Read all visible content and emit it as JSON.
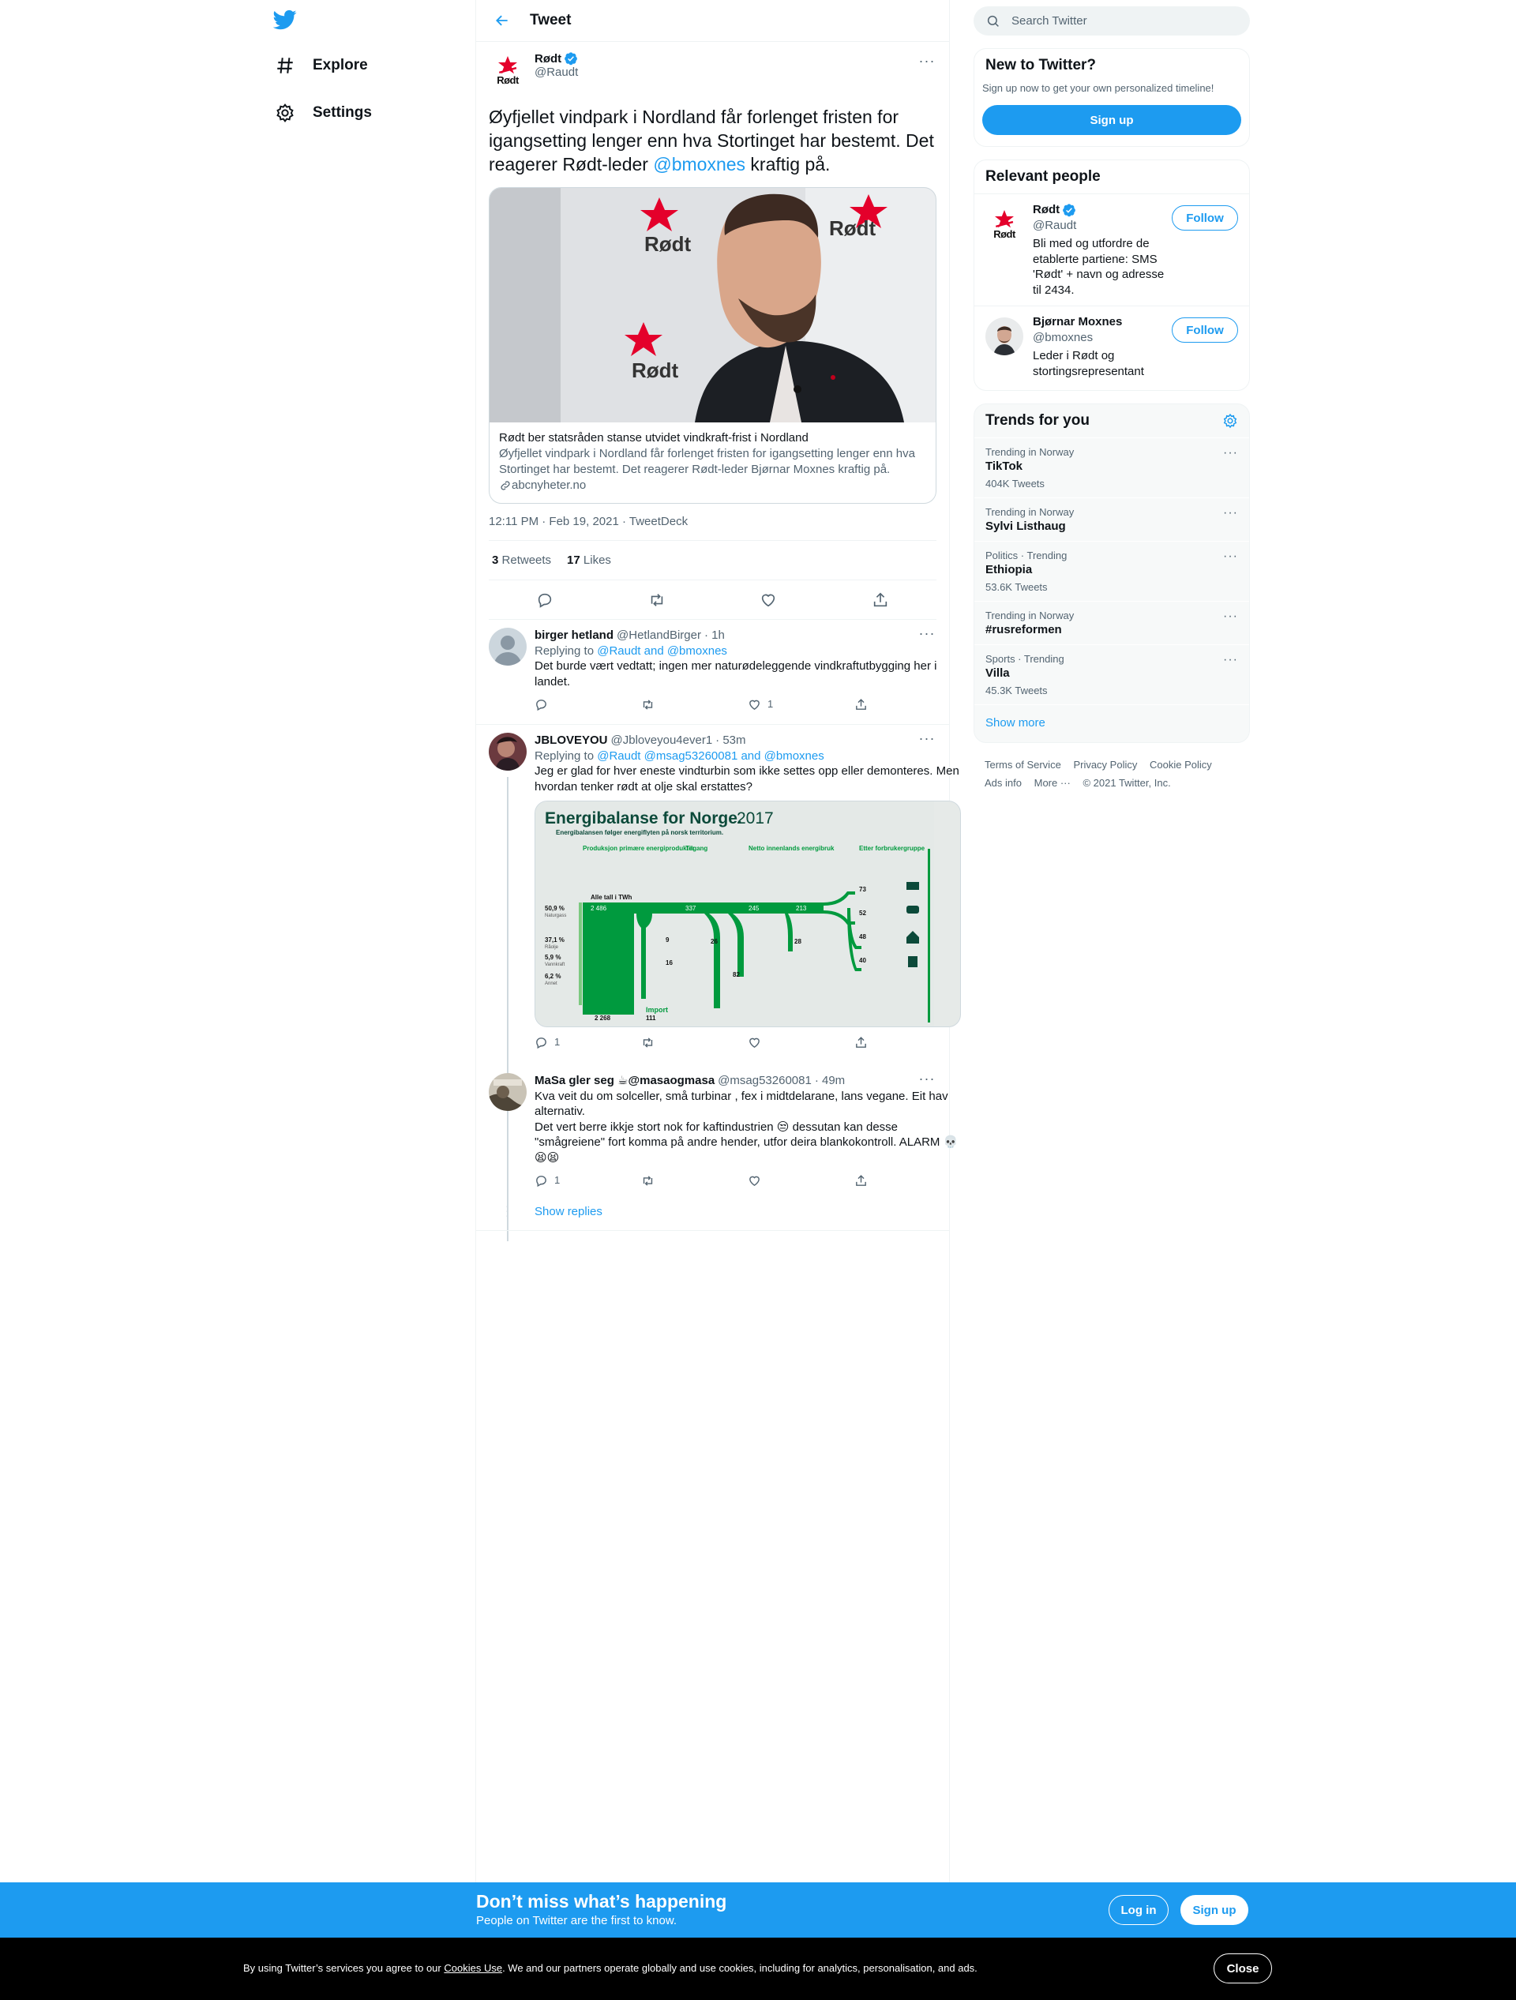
{
  "nav": {
    "explore": "Explore",
    "settings": "Settings"
  },
  "header": {
    "title": "Tweet"
  },
  "main_tweet": {
    "name": "Rødt",
    "handle": "@Raudt",
    "logo_word": "Rødt",
    "text_before": "Øyfjellet vindpark i Nordland får forlenget fristen for igangsetting lenger enn hva Stortinget har bestemt. Det reagerer Rødt-leder ",
    "text_mention": "@bmoxnes",
    "text_after": " kraftig på.",
    "card": {
      "title": "Rødt ber statsråden stanse utvidet vindkraft-frist i Nordland",
      "description": "Øyfjellet vindpark i Nordland får forlenget fristen for igangsetting lenger enn hva Stortinget har bestemt. Det reagerer Rødt-leder Bjørnar Moxnes kraftig på.",
      "domain": "abcnyheter.no",
      "backdrop_word": "Rødt"
    },
    "timestamp": "12:11 PM · Feb 19, 2021",
    "separator": " · ",
    "source": "TweetDeck",
    "retweets": "3",
    "retweets_label": "Retweets",
    "likes": "17",
    "likes_label": "Likes"
  },
  "replies": [
    {
      "name": "birger hetland",
      "handle": "@HetlandBirger",
      "time": "· 1h",
      "replying_prefix": "Replying to ",
      "replying_mentions": "@Raudt and @bmoxnes",
      "text": "Det burde vært vedtatt; ingen mer naturødeleggende vindkraftutbygging her i landet.",
      "reply_count": "",
      "like_count": "1"
    },
    {
      "name": "JBLOVEYOU",
      "handle": "@Jbloveyou4ever1",
      "time": "· 53m",
      "replying_prefix": "Replying to ",
      "replying_mentions": "@Raudt @msag53260081 and @bmoxnes",
      "text": "Jeg er glad for hver eneste vindturbin som ikke settes opp eller demonteres. Men hvordan tenker rødt at olje skal erstattes?",
      "reply_count": "1",
      "like_count": ""
    },
    {
      "name": "MaSa gler seg ☕@masaogmasa",
      "handle": "@msag53260081",
      "time": "· 49m",
      "text": "Kva veit du om solceller, små turbinar , fex i midtdelarane, lans vegane. Eit hav alternativ.\nDet vert berre ikkje stort nok for kaftindustrien 😒 dessutan kan desse \"smågreiene\" fort komma på andre hender, utfor deira blankokontroll. ALARM 💀😫😫",
      "reply_count": "1",
      "like_count": ""
    }
  ],
  "show_replies": "Show replies",
  "infographic": {
    "title": "Energibalanse for Norge.",
    "year": "2017",
    "subtitle": "Energibalansen følger energiflyten på norsk territorium.",
    "col1": "Produksjon primære energiprodukter",
    "col2": "Tilgang",
    "col3": "Netto innenlands energibruk",
    "col4": "Etter forbrukergruppe",
    "units": "Alle tall i TWh",
    "total": "2 486",
    "v337": "337",
    "v245": "245",
    "v213": "213",
    "p1": "50,9 %",
    "p1_label": "Naturgass",
    "p2": "37,1 %",
    "p2_label": "Råolje",
    "p3": "5,9 %",
    "p3_label": "Vannkraft",
    "p4": "6,2 %",
    "p4_label": "Annet",
    "n9": "9",
    "n16": "16",
    "n26": "26",
    "n82": "82",
    "n28": "28",
    "c73": "73",
    "c52": "52",
    "c48": "48",
    "c40": "40",
    "eksport_label": "Eksport",
    "eksport": "2 268",
    "import_label": "Import",
    "import": "111"
  },
  "right": {
    "search_placeholder": "Search Twitter",
    "new_title": "New to Twitter?",
    "new_text": "Sign up now to get your own personalized timeline!",
    "signup": "Sign up",
    "relevant_title": "Relevant people",
    "people": [
      {
        "name": "Rødt",
        "handle": "@Raudt",
        "bio": "Bli med og utfordre de etablerte partiene: SMS 'Rødt' + navn og adresse til 2434.",
        "follow": "Follow"
      },
      {
        "name": "Bjørnar Moxnes",
        "handle": "@bmoxnes",
        "bio": "Leder i Rødt og stortingsrepresentant",
        "follow": "Follow"
      }
    ],
    "trends_title": "Trends for you",
    "trends": [
      {
        "context": "Trending in Norway",
        "title": "TikTok",
        "count": "404K Tweets"
      },
      {
        "context": "Trending in Norway",
        "title": "Sylvi Listhaug",
        "count": ""
      },
      {
        "context": "Politics · Trending",
        "title": "Ethiopia",
        "count": "53.6K Tweets"
      },
      {
        "context": "Trending in Norway",
        "title": "#rusreformen",
        "count": ""
      },
      {
        "context": "Sports · Trending",
        "title": "Villa",
        "count": "45.3K Tweets"
      }
    ],
    "show_more": "Show more",
    "footer": {
      "terms": "Terms of Service",
      "privacy": "Privacy Policy",
      "cookie": "Cookie Policy",
      "ads": "Ads info",
      "more": "More ···",
      "copyright": "© 2021 Twitter, Inc."
    }
  },
  "promo": {
    "title": "Don’t miss what’s happening",
    "subtitle": "People on Twitter are the first to know.",
    "login": "Log in",
    "signup": "Sign up"
  },
  "cookie": {
    "text_before": "By using Twitter’s services you agree to our ",
    "link": "Cookies Use",
    "text_after": ". We and our partners operate globally and use cookies, including for analytics, personalisation, and ads.",
    "close": "Close"
  },
  "colors": {
    "accent": "#1d9bf0",
    "text": "#0f1419",
    "secondary": "#536471",
    "rodt_red": "#e4002b",
    "infographic_green": "#009a3e"
  },
  "icons": [
    "twitter-logo-icon",
    "hashtag-icon",
    "gear-icon",
    "back-arrow-icon",
    "verified-icon",
    "more-icon",
    "reply-icon",
    "retweet-icon",
    "like-icon",
    "share-icon",
    "link-icon",
    "search-icon"
  ]
}
